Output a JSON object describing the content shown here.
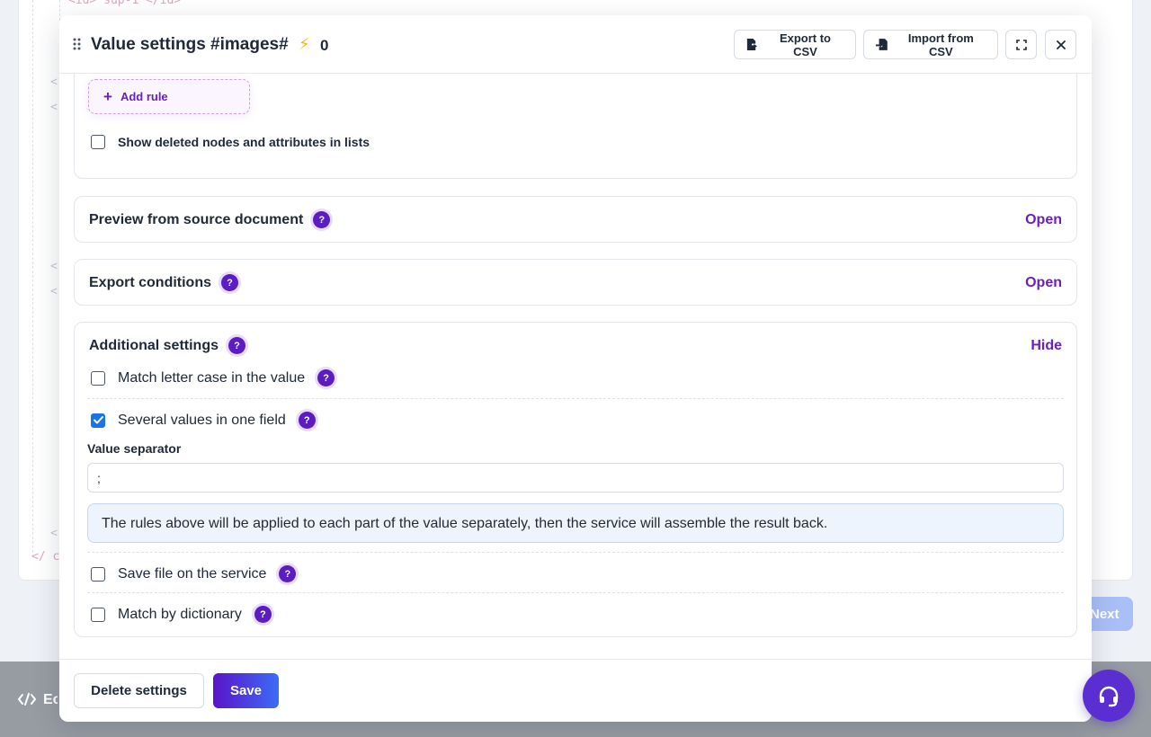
{
  "background": {
    "code_top": "<id> sup-1 </id>",
    "code_left_marks": [
      "<",
      "<",
      "<",
      "<",
      "<"
    ],
    "code_close": "</ c",
    "next_button_label": "Next",
    "footer_brand_label": "Ec"
  },
  "modal": {
    "title": "Value settings #images#",
    "bolt_icon": "bolt-icon",
    "bolt_count": "0",
    "export_csv_label": "Export to CSV",
    "import_csv_label": "Import from CSV"
  },
  "rules": {
    "add_rule_label": "Add rule",
    "show_deleted_label": "Show deleted nodes and attributes in lists",
    "show_deleted_checked": false
  },
  "panels": {
    "preview": {
      "title": "Preview from source document",
      "toggle": "Open"
    },
    "export_conditions": {
      "title": "Export conditions",
      "toggle": "Open"
    },
    "additional": {
      "title": "Additional settings",
      "toggle": "Hide",
      "match_case": {
        "label": "Match letter case in the value",
        "checked": false
      },
      "several_values": {
        "label": "Several values in one field",
        "checked": true
      },
      "separator": {
        "label": "Value separator",
        "value": ";",
        "note": "The rules above will be applied to each part of the value separately, then the service will assemble the result back."
      },
      "save_file": {
        "label": "Save file on the service",
        "checked": false
      },
      "dictionary": {
        "label": "Match by dictionary",
        "checked": false
      }
    }
  },
  "help_icon_glyph": "?",
  "footer": {
    "delete_label": "Delete settings",
    "save_label": "Save"
  },
  "colors": {
    "accent": "#6a1fc6",
    "help_icon": "#5b1cc1",
    "checkbox_checked": "#1a73e8",
    "support_fab": "#5b2ed1"
  }
}
